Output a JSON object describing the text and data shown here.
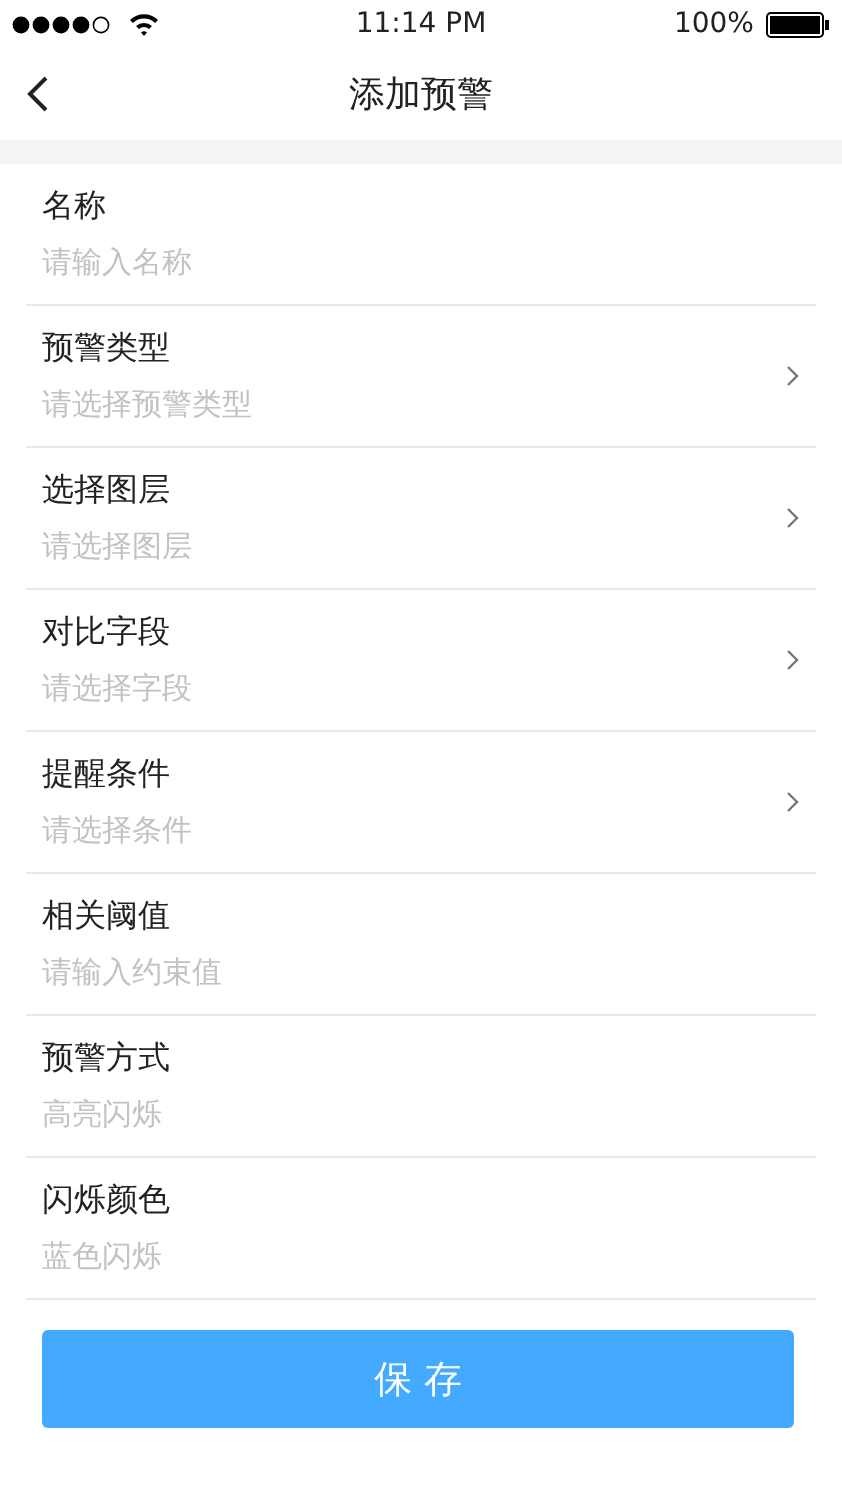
{
  "status_bar": {
    "time": "11:14 PM",
    "battery": "100%"
  },
  "nav": {
    "title": "添加预警"
  },
  "fields": [
    {
      "label": "名称",
      "hint": "请输入名称",
      "kind": "input"
    },
    {
      "label": "预警类型",
      "hint": "请选择预警类型",
      "kind": "select"
    },
    {
      "label": "选择图层",
      "hint": "请选择图层",
      "kind": "select"
    },
    {
      "label": "对比字段",
      "hint": "请选择字段",
      "kind": "select"
    },
    {
      "label": "提醒条件",
      "hint": "请选择条件",
      "kind": "select"
    },
    {
      "label": "相关阈值",
      "hint": "请输入约束值",
      "kind": "input"
    },
    {
      "label": "预警方式",
      "hint": "高亮闪烁",
      "kind": "input"
    },
    {
      "label": "闪烁颜色",
      "hint": "蓝色闪烁",
      "kind": "input"
    }
  ],
  "save_button": "保 存"
}
